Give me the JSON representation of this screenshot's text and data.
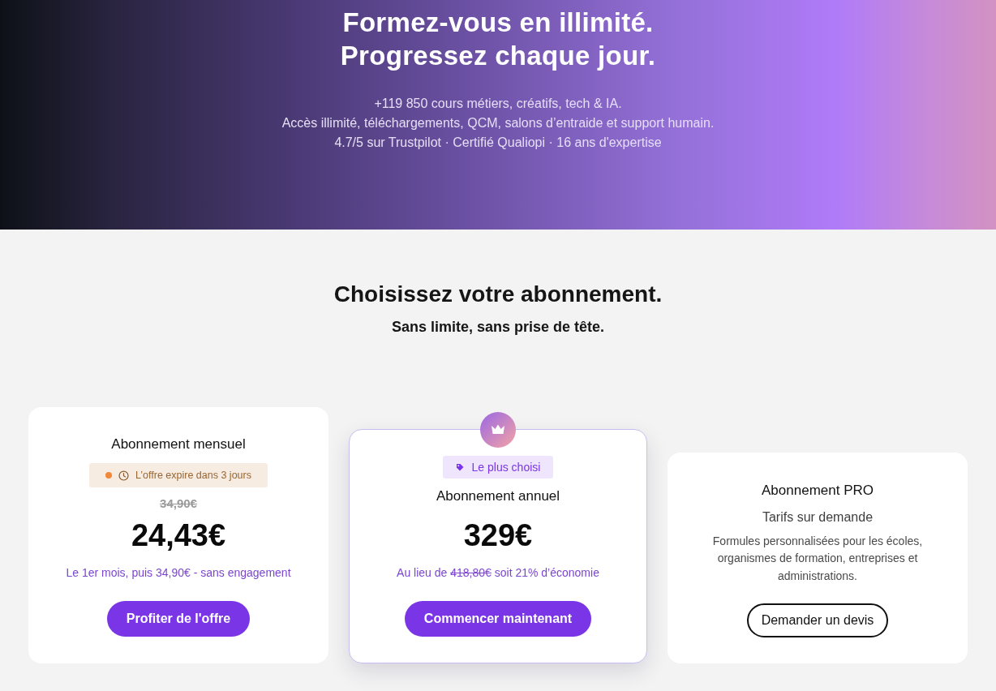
{
  "hero": {
    "title_lines": [
      "Formez-vous en illimité.",
      "Progressez chaque jour."
    ],
    "lines": [
      "+119 850 cours métiers, créatifs, tech & IA.",
      "Accès illimité, téléchargements, QCM, salons d’entraide et support humain.",
      "4.7/5 sur Trustpilot · Certifié Qualiopi · 16 ans d'expertise"
    ]
  },
  "pricing": {
    "title": "Choisissez votre abonnement.",
    "subtitle": "Sans limite, sans prise de tête.",
    "plans": [
      {
        "kind": "promo",
        "title": "Abonnement mensuel",
        "badge": "L’offre expire dans 3 jours",
        "old_price": "34,90€",
        "price": "24,43€",
        "note": {
          "lead": "Le 1er mois, puis 34,90€ - sans engagement"
        },
        "button": "Profiter de l'offre"
      },
      {
        "kind": "featured",
        "tag": "Le plus choisi",
        "title": "Abonnement annuel",
        "price": "329€",
        "note": {
          "lead": "Au lieu de",
          "struck": "418,80€",
          "tail": "soit 21% d’économie"
        },
        "button": "Commencer maintenant"
      },
      {
        "kind": "pro",
        "title": "Abonnement PRO",
        "subtitle": "Tarifs sur demande",
        "description": "Formules personnalisées pour les écoles, organismes de formation, entreprises et administrations.",
        "button": "Demander un devis"
      }
    ]
  }
}
